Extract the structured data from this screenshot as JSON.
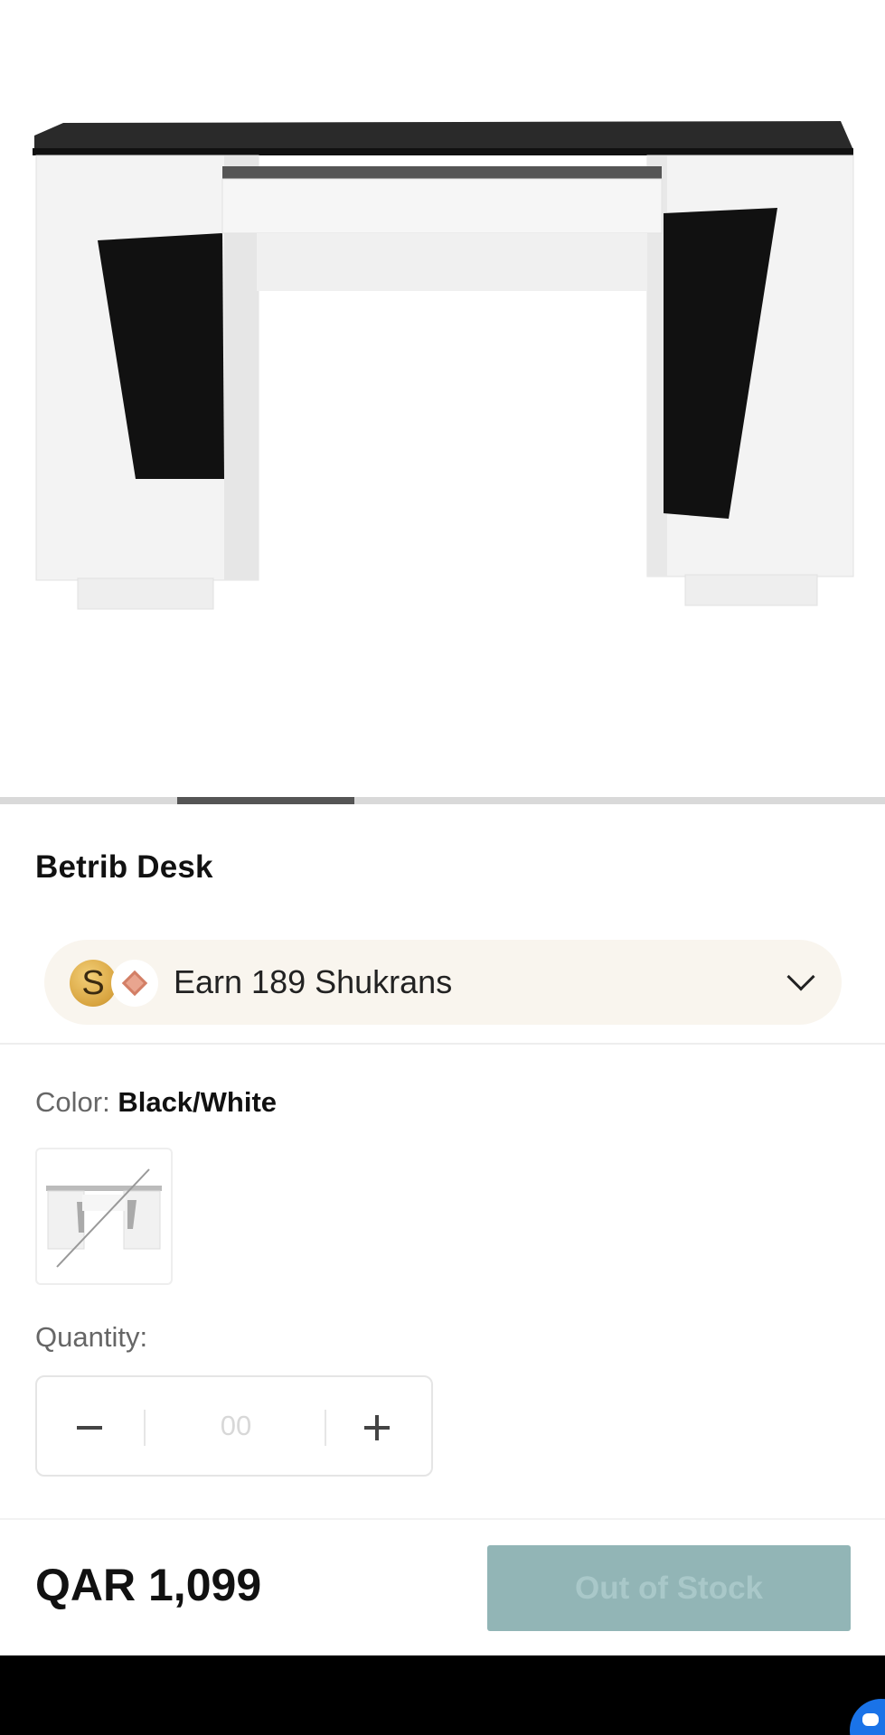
{
  "product": {
    "title": "Betrib Desk",
    "image_icon": "desk-product-image"
  },
  "carousel": {
    "total_slides": 5,
    "active_index": 1
  },
  "shukran": {
    "text": "Earn 189 Shukrans",
    "coin_letter": "S",
    "coin_icon": "shukran-coin-icon",
    "badge_icon": "diamond-badge-icon",
    "chevron_icon": "chevron-down-icon"
  },
  "color": {
    "label": "Color:",
    "value": "Black/White",
    "swatch_icon": "desk-swatch-crossed-out"
  },
  "quantity": {
    "label": "Quantity:",
    "value": "00",
    "minus_icon": "minus-icon",
    "plus_icon": "plus-icon"
  },
  "footer": {
    "price": "QAR 1,099",
    "button_label": "Out of Stock",
    "button_color": "#92b5b6"
  },
  "colors": {
    "accent_pill_bg": "#f9f5ee",
    "carousel_active": "#555555",
    "carousel_inactive": "#d9d9d9",
    "system_bar": "#000000",
    "chat_fab": "#1a73e8"
  }
}
